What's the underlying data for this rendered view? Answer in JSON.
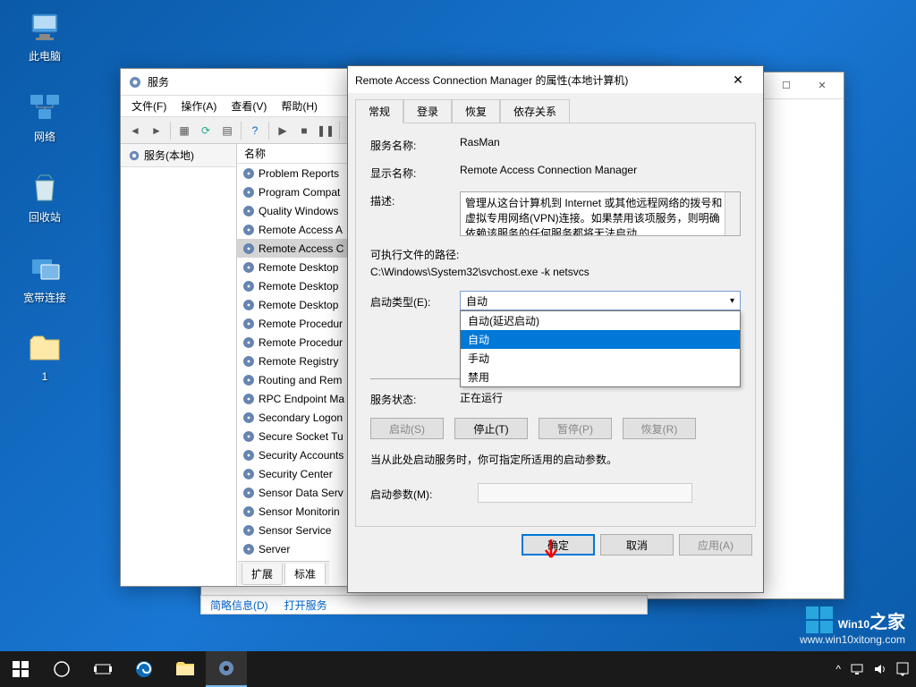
{
  "desktop": {
    "icons": [
      "此电脑",
      "网络",
      "回收站",
      "宽带连接",
      "1"
    ]
  },
  "services_window": {
    "title": "服务",
    "menu": [
      "文件(F)",
      "操作(A)",
      "查看(V)",
      "帮助(H)"
    ],
    "tree_label": "服务(本地)",
    "col_name": "名称",
    "items": [
      "Problem Reports",
      "Program Compat",
      "Quality Windows",
      "Remote Access A",
      "Remote Access C",
      "Remote Desktop",
      "Remote Desktop",
      "Remote Desktop",
      "Remote Procedur",
      "Remote Procedur",
      "Remote Registry",
      "Routing and Rem",
      "RPC Endpoint Ma",
      "Secondary Logon",
      "Secure Socket Tu",
      "Security Accounts",
      "Security Center",
      "Sensor Data Serv",
      "Sensor Monitorin",
      "Sensor Service",
      "Server"
    ],
    "selected_index": 4,
    "tabs_bottom": [
      "扩展",
      "标准"
    ],
    "link1": "简略信息(D)",
    "link2": "打开服务"
  },
  "dlg": {
    "title": "Remote Access Connection Manager 的属性(本地计算机)",
    "tabs": [
      "常规",
      "登录",
      "恢复",
      "依存关系"
    ],
    "lbl_service_name": "服务名称:",
    "service_name": "RasMan",
    "lbl_display_name": "显示名称:",
    "display_name": "Remote Access Connection Manager",
    "lbl_desc": "描述:",
    "desc": "管理从这台计算机到 Internet 或其他远程网络的拨号和虚拟专用网络(VPN)连接。如果禁用该项服务，则明确依赖该服务的任何服务都将无法启动",
    "lbl_exe": "可执行文件的路径:",
    "exe": "C:\\Windows\\System32\\svchost.exe -k netsvcs",
    "lbl_startup": "启动类型(E):",
    "startup_value": "自动",
    "startup_options": [
      "自动(延迟启动)",
      "自动",
      "手动",
      "禁用"
    ],
    "lbl_status": "服务状态:",
    "status": "正在运行",
    "btn_start": "启动(S)",
    "btn_stop": "停止(T)",
    "btn_pause": "暂停(P)",
    "btn_resume": "恢复(R)",
    "help_text": "当从此处启动服务时，你可指定所适用的启动参数。",
    "lbl_params": "启动参数(M):",
    "btn_ok": "确定",
    "btn_cancel": "取消",
    "btn_apply": "应用(A)"
  },
  "taskbar": {
    "time": "",
    "tray_items": [
      "^"
    ]
  },
  "watermark": {
    "brand": "Win10",
    "suffix": "之家",
    "url": "www.win10xitong.com"
  }
}
